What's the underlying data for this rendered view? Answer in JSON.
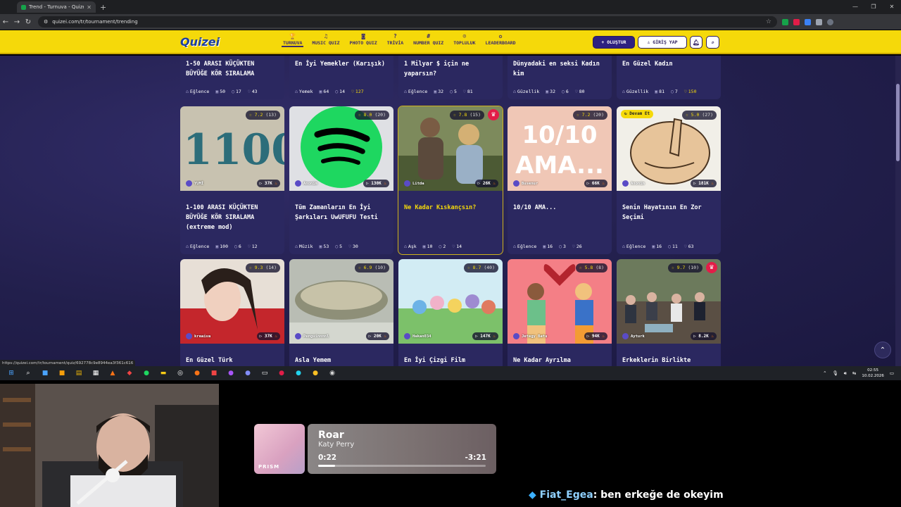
{
  "browser": {
    "tab_title": "Trend - Turnuva - Quizei",
    "url": "quizei.com/tr/tournament/trending",
    "status_url": "https://quizei.com/tr/tournament/quiz/692778c9e8944ea3f361c616"
  },
  "site": {
    "logo": "Quizei",
    "nav": [
      {
        "label": "TURNUVA",
        "icon": "trophy-icon",
        "glyph": "🏆",
        "active": true
      },
      {
        "label": "MUSIC QUIZ",
        "icon": "music-icon",
        "glyph": "♫",
        "active": false
      },
      {
        "label": "PHOTO QUIZ",
        "icon": "camera-icon",
        "glyph": "◙",
        "active": false
      },
      {
        "label": "TRİVİA",
        "icon": "question-icon",
        "glyph": "?",
        "active": false
      },
      {
        "label": "NUMBER QUIZ",
        "icon": "hash-icon",
        "glyph": "#",
        "active": false
      },
      {
        "label": "TOPLULUK",
        "icon": "users-icon",
        "glyph": "☺",
        "active": false
      },
      {
        "label": "LEADERBOARD",
        "icon": "medal-icon",
        "glyph": "✪",
        "active": false
      }
    ],
    "create_label": "+ OLUŞTUR",
    "login_label": "♙ GİRİŞ YAP"
  },
  "top_row": [
    {
      "title": "1-50 ARASI KÜÇÜKTEN BÜYÜĞE KÖR SIRALAMA",
      "category": "Eğlence",
      "items": "50",
      "comments": "17",
      "likes": "43",
      "liked": false
    },
    {
      "title": "En İyi Yemekler (Karışık)",
      "category": "Yemek",
      "items": "64",
      "comments": "14",
      "likes": "127",
      "liked": true
    },
    {
      "title": "1 Milyar $ için ne yaparsın?",
      "category": "Eğlence",
      "items": "32",
      "comments": "5",
      "likes": "81",
      "liked": false
    },
    {
      "title": "Dünyadaki en seksi Kadın kim",
      "category": "Güzellik",
      "items": "32",
      "comments": "6",
      "likes": "80",
      "liked": false
    },
    {
      "title": "En Güzel Kadın",
      "category": "Güzellik",
      "items": "81",
      "comments": "7",
      "likes": "150",
      "liked": true
    }
  ],
  "mid_row": [
    {
      "rating": "7.2",
      "count": "(13)",
      "author": "YUMİ",
      "plays": "37K",
      "title": "1-100 ARASI KÜÇÜKTEN BÜYÜĞE KÖR SIRALAMA (extreme mod)",
      "category": "Eğlence",
      "items": "100",
      "comments": "6",
      "likes": "12",
      "crown": false,
      "continue": "",
      "selected": false,
      "art": "num"
    },
    {
      "rating": "8.0",
      "count": "(20)",
      "author": "Anonim",
      "plays": "130K",
      "title": "Tüm Zamanların En İyi Şarkıları UwUFUFU Testi",
      "category": "Müzik",
      "items": "53",
      "comments": "5",
      "likes": "30",
      "crown": false,
      "continue": "",
      "selected": false,
      "art": "spotify"
    },
    {
      "rating": "7.8",
      "count": "(15)",
      "author": "Litda",
      "plays": "26K",
      "title": "Ne Kadar Kıskançsın?",
      "category": "Aşk",
      "items": "10",
      "comments": "2",
      "likes": "14",
      "crown": true,
      "continue": "",
      "selected": true,
      "art": "couple"
    },
    {
      "rating": "7.2",
      "count": "(20)",
      "author": "Busenur",
      "plays": "66K",
      "title": "10/10 AMA...",
      "category": "Eğlence",
      "items": "16",
      "comments": "3",
      "likes": "26",
      "crown": false,
      "continue": "",
      "selected": false,
      "art": "text"
    },
    {
      "rating": "5.0",
      "count": "(27)",
      "author": "Anonim",
      "plays": "181K",
      "title": "Senin Hayatının En Zor Seçimi",
      "category": "Eğlence",
      "items": "16",
      "comments": "11",
      "likes": "63",
      "crown": false,
      "continue": "Devam Et",
      "selected": false,
      "art": "point"
    }
  ],
  "bottom_row": [
    {
      "rating": "9.3",
      "count": "(14)",
      "author": "kreaiva",
      "plays": "37K",
      "title": "En Güzel Türk",
      "crown": false,
      "art": "woman"
    },
    {
      "rating": "6.9",
      "count": "(10)",
      "author": "Penguinnnnl",
      "plays": "20K",
      "title": "Asla Yemem",
      "crown": false,
      "art": "food"
    },
    {
      "rating": "8.7",
      "count": "(40)",
      "author": "Hakan034",
      "plays": "147K",
      "title": "En İyi Çizgi Film",
      "crown": false,
      "art": "cartoon"
    },
    {
      "rating": "5.8",
      "count": "(8)",
      "author": "Jetegy Batu",
      "plays": "94K",
      "title": "Ne Kadar Ayrılma",
      "crown": false,
      "art": "breakup"
    },
    {
      "rating": "9.7",
      "count": "(10)",
      "author": "Ayturk",
      "plays": "8.2K",
      "title": "Erkeklerin Birlikte",
      "crown": true,
      "art": "crowd"
    }
  ],
  "art_text": {
    "num": "1100",
    "tenten": "10/10 AMA..."
  },
  "taskbar": {
    "time": "02:55",
    "date": "10.02.2026"
  },
  "now_playing": {
    "song": "Roar",
    "artist": "Katy Perry",
    "elapsed": "0:22",
    "remaining": "-3:21",
    "progress": 0.1,
    "cover_text": "PRISM"
  },
  "chat": {
    "user": "Fiat_Egea",
    "message": ": ben erkeğe de okeyim"
  }
}
